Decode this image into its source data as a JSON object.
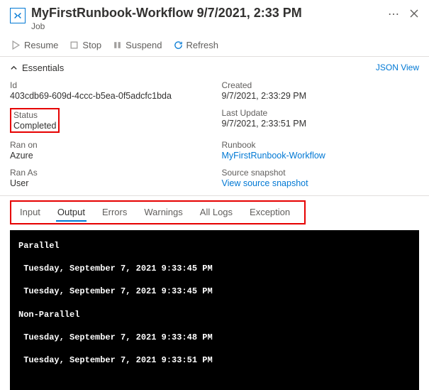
{
  "header": {
    "title": "MyFirstRunbook-Workflow 9/7/2021, 2:33 PM",
    "subtitle": "Job"
  },
  "toolbar": {
    "resume": "Resume",
    "stop": "Stop",
    "suspend": "Suspend",
    "refresh": "Refresh"
  },
  "essentials": {
    "label": "Essentials",
    "json_view": "JSON View",
    "left": [
      {
        "k": "Id",
        "v": "403cdb69-609d-4ccc-b5ea-0f5adcfc1bda"
      },
      {
        "k": "Status",
        "v": "Completed",
        "highlight": true
      },
      {
        "k": "Ran on",
        "v": "Azure"
      },
      {
        "k": "Ran As",
        "v": "User"
      }
    ],
    "right": [
      {
        "k": "Created",
        "v": "9/7/2021, 2:33:29 PM"
      },
      {
        "k": "Last Update",
        "v": "9/7/2021, 2:33:51 PM"
      },
      {
        "k": "Runbook",
        "v": "MyFirstRunbook-Workflow",
        "link": true
      },
      {
        "k": "Source snapshot",
        "v": "View source snapshot",
        "link": true
      }
    ]
  },
  "tabs": {
    "items": [
      "Input",
      "Output",
      "Errors",
      "Warnings",
      "All Logs",
      "Exception"
    ],
    "active": "Output"
  },
  "output": {
    "sections": [
      {
        "heading": "Parallel",
        "lines": [
          "Tuesday, September 7, 2021 9:33:45 PM",
          "Tuesday, September 7, 2021 9:33:45 PM"
        ]
      },
      {
        "heading": "Non-Parallel",
        "lines": [
          "Tuesday, September 7, 2021 9:33:48 PM",
          "Tuesday, September 7, 2021 9:33:51 PM"
        ]
      }
    ]
  }
}
